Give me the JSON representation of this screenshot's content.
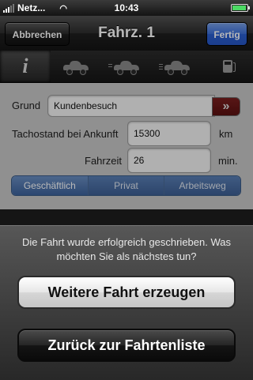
{
  "status_bar": {
    "carrier": "Netz...",
    "time": "10:43",
    "battery_level": 0.95
  },
  "nav": {
    "title": "Fahrz. 1",
    "cancel_label": "Abbrechen",
    "done_label": "Fertig"
  },
  "toolbar": {
    "items": [
      {
        "icon": "info-icon",
        "glyph": "i",
        "active": true
      },
      {
        "icon": "car-icon"
      },
      {
        "icon": "car-moving-icon"
      },
      {
        "icon": "car-fast-icon"
      },
      {
        "icon": "fuel-pump-icon"
      }
    ]
  },
  "form": {
    "grund_label": "Grund",
    "grund_value": "Kundenbesuch",
    "chevron": "»",
    "tacho_label": "Tachostand bei Ankunft",
    "tacho_value": "15300",
    "tacho_unit": "km",
    "fahrzeit_label": "Fahrzeit",
    "fahrzeit_value": "26",
    "fahrzeit_unit": "min.",
    "segments": [
      "Geschäftlich",
      "Privat",
      "Arbeitsweg"
    ],
    "selected_segment": "Geschäftlich"
  },
  "sheet": {
    "message": "Die Fahrt wurde erfolgreich geschrieben. Was möchten Sie als nächstes tun?",
    "primary_label": "Weitere Fahrt erzeugen",
    "secondary_label": "Zurück zur Fahrtenliste"
  },
  "colors": {
    "done_button": "#3c6fd9",
    "segment_blue": "#3c629c",
    "chevron_red": "#7a1f1f"
  }
}
